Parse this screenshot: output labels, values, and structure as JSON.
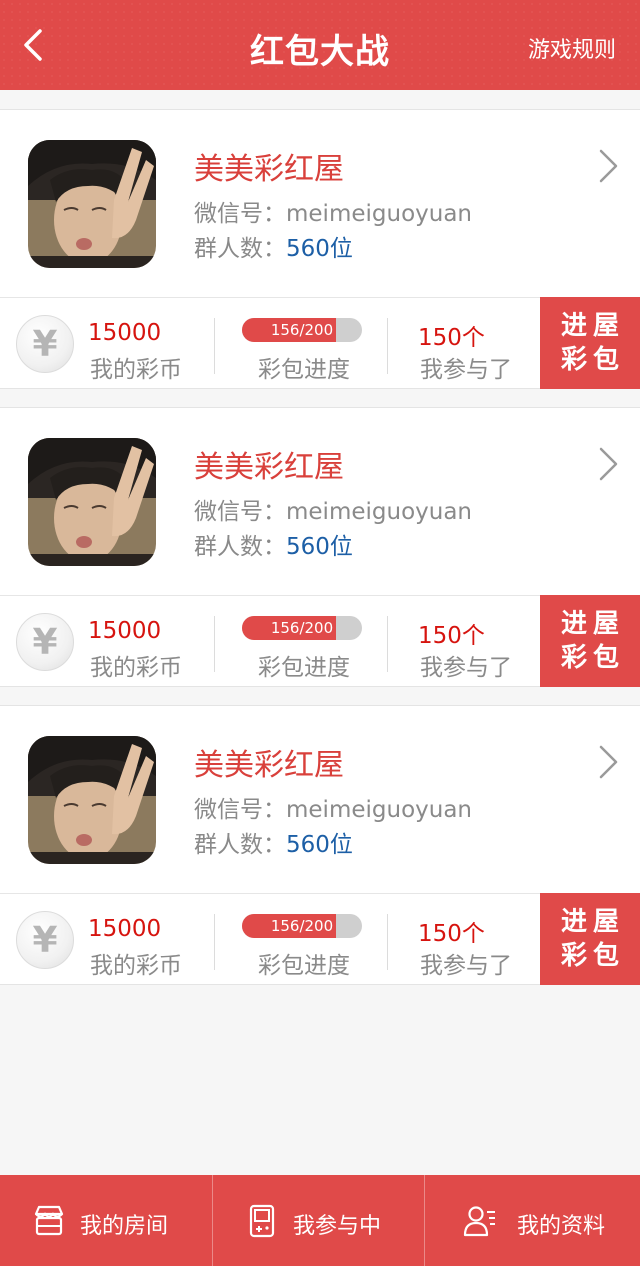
{
  "header": {
    "title": "红包大战",
    "rules_label": "游戏规则",
    "back_icon": "chevron-left-icon"
  },
  "rooms": [
    {
      "name": "美美彩红屋",
      "wechat_label": "微信号：",
      "wechat_id": "meimeiguoyuan",
      "members_label": "群人数：",
      "members_value": "560位",
      "coins_value": "15000",
      "coins_label": "我的彩币",
      "progress_text": "156/200",
      "progress_fraction": 0.78,
      "progress_label": "彩包进度",
      "joined_value": "150个",
      "joined_label": "我参与了",
      "enter_line1": "进屋",
      "enter_line2": "彩包"
    },
    {
      "name": "美美彩红屋",
      "wechat_label": "微信号：",
      "wechat_id": "meimeiguoyuan",
      "members_label": "群人数：",
      "members_value": "560位",
      "coins_value": "15000",
      "coins_label": "我的彩币",
      "progress_text": "156/200",
      "progress_fraction": 0.78,
      "progress_label": "彩包进度",
      "joined_value": "150个",
      "joined_label": "我参与了",
      "enter_line1": "进屋",
      "enter_line2": "彩包"
    },
    {
      "name": "美美彩红屋",
      "wechat_label": "微信号：",
      "wechat_id": "meimeiguoyuan",
      "members_label": "群人数：",
      "members_value": "560位",
      "coins_value": "15000",
      "coins_label": "我的彩币",
      "progress_text": "156/200",
      "progress_fraction": 0.78,
      "progress_label": "彩包进度",
      "joined_value": "150个",
      "joined_label": "我参与了",
      "enter_line1": "进屋",
      "enter_line2": "彩包"
    }
  ],
  "coin_symbol": "¥",
  "tabbar": {
    "items": [
      {
        "label": "我的房间",
        "icon": "room-icon"
      },
      {
        "label": "我参与中",
        "icon": "gameboy-icon"
      },
      {
        "label": "我的资料",
        "icon": "profile-icon"
      }
    ]
  },
  "colors": {
    "brand_red": "#e04a49",
    "room_name": "#d9403b",
    "value_red": "#d6140f",
    "members_blue": "#1d5fa6",
    "label_gray": "#8a8a8a"
  }
}
